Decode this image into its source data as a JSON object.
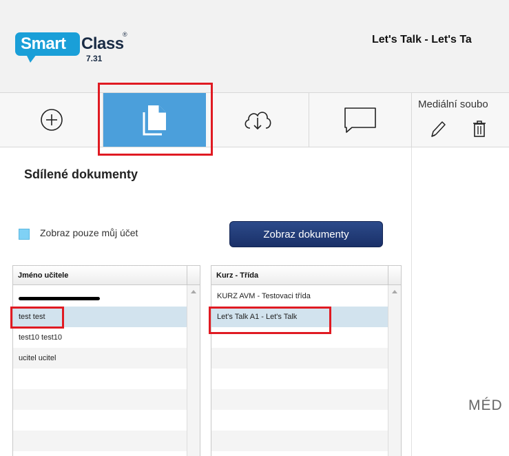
{
  "header": {
    "logo_smart": "Smart",
    "logo_class": "Class",
    "logo_reg": "®",
    "version": "7.31",
    "title": "Let's Talk - Let's Ta"
  },
  "toolbar": {
    "tabs": [
      {
        "icon": "plus-circle-icon",
        "active": false
      },
      {
        "icon": "documents-icon",
        "active": true
      },
      {
        "icon": "cloud-download-icon",
        "active": false
      },
      {
        "icon": "chat-bubble-icon",
        "active": false
      }
    ],
    "active_color": "#4b9fdb"
  },
  "media": {
    "label": "Mediální soubo",
    "edit_icon": "pencil-icon",
    "delete_icon": "trash-icon"
  },
  "left": {
    "section_title": "Sdílené dokumenty",
    "checkbox_label": "Zobraz pouze můj účet",
    "button_label": "Zobraz dokumenty"
  },
  "teachers": {
    "header": "Jméno učitele",
    "rows": [
      "",
      "test test",
      "test10 test10",
      "ucitel ucitel",
      "",
      "",
      "",
      ""
    ]
  },
  "courses": {
    "header": "Kurz - Třída",
    "rows": [
      "KURZ AVM - Testovaci třída",
      "Let's Talk A1 - Let's Talk",
      "",
      "",
      "",
      "",
      "",
      ""
    ]
  },
  "right": {
    "placeholder": "MÉD"
  }
}
